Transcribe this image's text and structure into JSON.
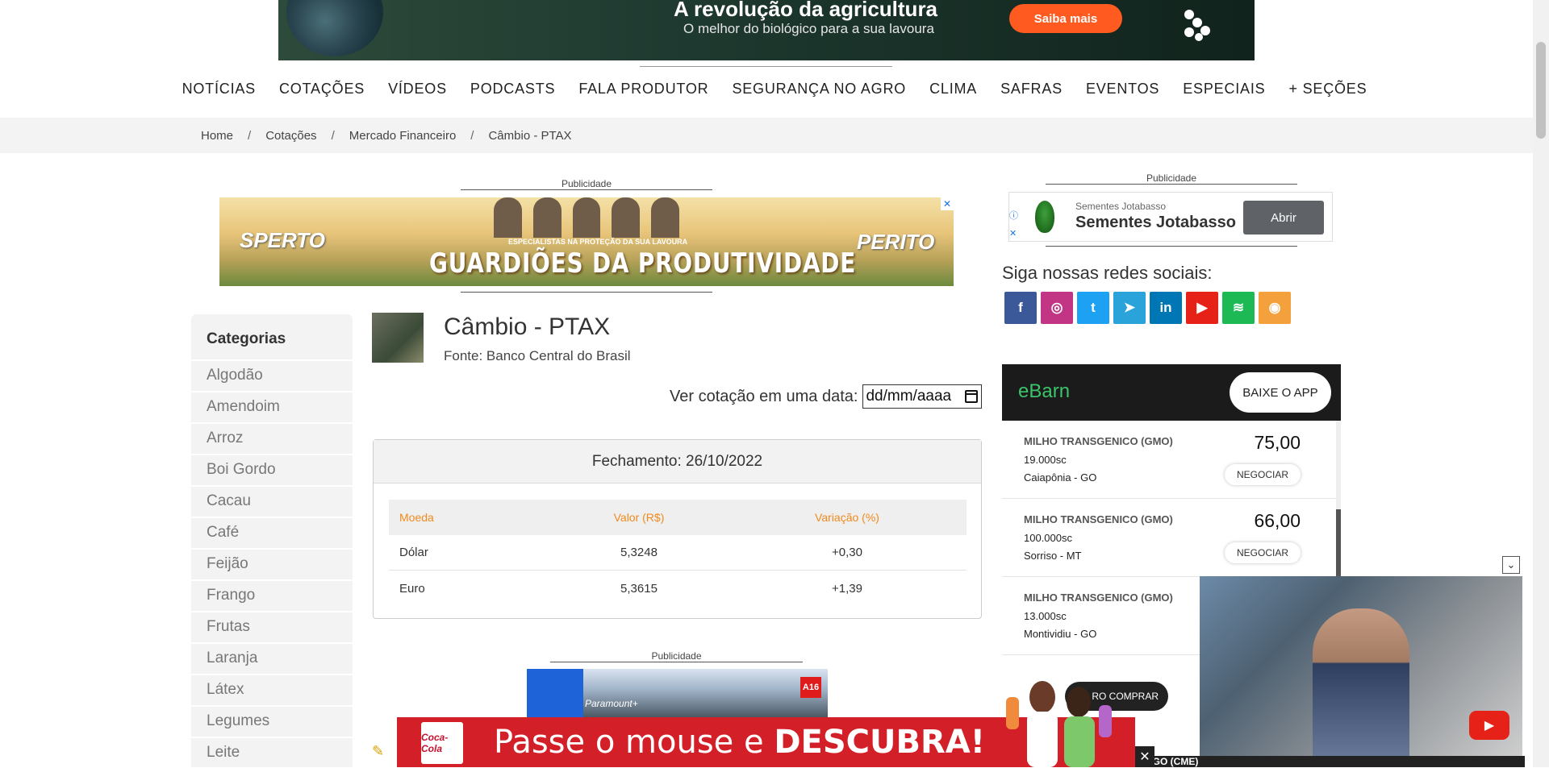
{
  "top_banner": {
    "headline": "A revolução da agricultura",
    "subline": "O melhor do biológico para a sua lavoura",
    "cta": "Saiba mais"
  },
  "nav": {
    "items": [
      "NOTÍCIAS",
      "COTAÇÕES",
      "VÍDEOS",
      "PODCASTS",
      "FALA PRODUTOR",
      "SEGURANÇA NO AGRO",
      "CLIMA",
      "SAFRAS",
      "EVENTOS",
      "ESPECIAIS",
      "+ SEÇÕES"
    ]
  },
  "breadcrumb": {
    "items": [
      "Home",
      "Cotações",
      "Mercado Financeiro",
      "Câmbio - PTAX"
    ],
    "separator": "/"
  },
  "ads": {
    "label": "Publicidade",
    "main": {
      "left_brand": "SPERTO",
      "right_brand": "PERITO",
      "tagline": "ESPECIALISTAS NA PROTEÇÃO DA SUA LAVOURA",
      "slogan": "GUARDIÕES DA PRODUTIVIDADE"
    },
    "side": {
      "advertiser_small": "Sementes Jotabasso",
      "advertiser_big": "Sementes Jotabasso",
      "button": "Abrir"
    },
    "mid": {
      "brand": "Paramount+",
      "badge": "A16"
    },
    "bottom": {
      "logo": "Coca-Cola",
      "text_prefix": "Passe o mouse e ",
      "text_bold": "DESCUBRA!"
    }
  },
  "categories": {
    "title": "Categorias",
    "items": [
      "Algodão",
      "Amendoim",
      "Arroz",
      "Boi Gordo",
      "Cacau",
      "Café",
      "Feijão",
      "Frango",
      "Frutas",
      "Laranja",
      "Látex",
      "Legumes",
      "Leite"
    ]
  },
  "quote": {
    "title": "Câmbio - PTAX",
    "source": "Fonte: Banco Central do Brasil",
    "date_label": "Ver cotação em uma data:",
    "date_placeholder": "dd/mm/aaaa",
    "closing": "Fechamento: 26/10/2022",
    "table": {
      "headers": [
        "Moeda",
        "Valor (R$)",
        "Variação (%)"
      ],
      "rows": [
        [
          "Dólar",
          "5,3248",
          "+0,30"
        ],
        [
          "Euro",
          "5,3615",
          "+1,39"
        ]
      ]
    }
  },
  "social": {
    "title": "Siga nossas redes sociais:",
    "networks": [
      {
        "name": "facebook-icon",
        "glyph": "f",
        "color": "#3b5998"
      },
      {
        "name": "instagram-icon",
        "glyph": "◎",
        "color": "#c13584"
      },
      {
        "name": "twitter-icon",
        "glyph": "t",
        "color": "#1da1f2"
      },
      {
        "name": "telegram-icon",
        "glyph": "➤",
        "color": "#2aa3da"
      },
      {
        "name": "linkedin-icon",
        "glyph": "in",
        "color": "#0077b5"
      },
      {
        "name": "youtube-icon",
        "glyph": "▶",
        "color": "#e62117"
      },
      {
        "name": "spotify-icon",
        "glyph": "≋",
        "color": "#1db954"
      },
      {
        "name": "rss-icon",
        "glyph": "◉",
        "color": "#f4a13d"
      }
    ]
  },
  "ebarn": {
    "logo": "eBarn",
    "app_button": "BAIXE O APP",
    "offers": [
      {
        "name": "MILHO TRANSGENICO (GMO)",
        "qty": "19.000sc",
        "location": "Caiapônia - GO",
        "price": "75,00",
        "action": "NEGOCIAR"
      },
      {
        "name": "MILHO TRANSGENICO (GMO)",
        "qty": "100.000sc",
        "location": "Sorriso - MT",
        "price": "66,00",
        "action": "NEGOCIAR"
      },
      {
        "name": "MILHO TRANSGENICO (GMO)",
        "qty": "13.000sc",
        "location": "Montividiu - GO",
        "price": "",
        "action": ""
      }
    ],
    "partial_button": "RO COMPRAR"
  },
  "bottom_strip": "AGO (CME)"
}
